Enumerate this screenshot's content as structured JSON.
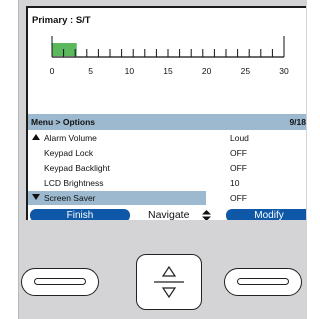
{
  "primary": {
    "label": "Primary : S/T",
    "scale_ticks": [
      "0",
      "5",
      "10",
      "15",
      "20",
      "25",
      "30"
    ],
    "level_value": 3.2,
    "level_color": "#5cb85c"
  },
  "menu": {
    "title": "Menu > Options",
    "page": "9/18",
    "items": [
      {
        "label": "Alarm Volume",
        "value": "Loud",
        "marker": "up",
        "selected": false
      },
      {
        "label": "Keypad Lock",
        "value": "OFF",
        "marker": "",
        "selected": false
      },
      {
        "label": "Keypad Backlight",
        "value": "OFF",
        "marker": "",
        "selected": false
      },
      {
        "label": "LCD Brightness",
        "value": "10",
        "marker": "",
        "selected": false
      },
      {
        "label": "Screen Saver",
        "value": "OFF",
        "marker": "down",
        "selected": true
      }
    ]
  },
  "softkeys": {
    "left": "Finish",
    "center": "Navigate",
    "right": "Modify"
  },
  "colors": {
    "accent": "#0f58a8",
    "highlight": "#9cb9cf",
    "panel": "#d4d4d6"
  }
}
